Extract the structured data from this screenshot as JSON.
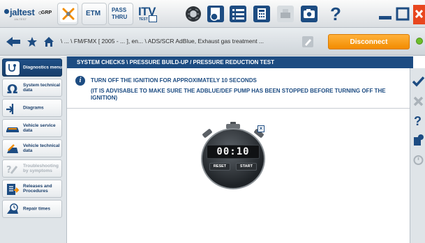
{
  "app": {
    "logo_text": "jaltest",
    "logo_sub": "JALTEST"
  },
  "toolbar": {
    "grp_label": "GRP",
    "etm_label": "ETM",
    "pass_line1": "PASS",
    "pass_line2": "THRU",
    "itv_label": "ITV",
    "itv_sub": "TEST",
    "help_label": "?"
  },
  "nav": {
    "breadcrumb": "\\ ... \\ FM/FMX [ 2005 - ... ], en... \\ ADS/SCR AdBlue, Exhaust gas treatment ...",
    "disconnect_label": "Disconnect",
    "status_color": "#6cbf2a"
  },
  "sidebar": {
    "items": [
      {
        "label": "Diagnostics menu",
        "icon": "stethoscope-icon",
        "state": "active"
      },
      {
        "label": "System technical data",
        "icon": "ohm-icon",
        "state": "normal"
      },
      {
        "label": "Diagrams",
        "icon": "diagram-icon",
        "state": "normal"
      },
      {
        "label": "Vehicle service data",
        "icon": "service-car-icon",
        "state": "normal"
      },
      {
        "label": "Vehicle technical data",
        "icon": "technical-car-icon",
        "state": "normal"
      },
      {
        "label": "Troubleshooting by symptoms",
        "icon": "troubleshooting-icon",
        "state": "disabled"
      },
      {
        "label": "Releases and Procedures",
        "icon": "releases-icon",
        "state": "normal"
      },
      {
        "label": "Repair times",
        "icon": "repair-times-icon",
        "state": "normal"
      }
    ]
  },
  "main": {
    "header": "SYSTEM CHECKS \\ PRESSURE BUILD-UP / PRESSURE REDUCTION TEST",
    "instruction": "TURN OFF THE IGNITION FOR APPROXIMATELY 10 SECONDS",
    "advice": "(IT IS ADVISABLE TO MAKE SURE THE ADBLUE/DEF PUMP HAS BEEN STOPPED BEFORE TURNING OFF THE IGNITION)",
    "stopwatch": {
      "display": "00:10",
      "reset_label": "RESET",
      "start_label": "START",
      "close_label": "×"
    }
  },
  "colors": {
    "brand_blue": "#1d4c82",
    "accent_orange": "#f28c00",
    "close_red": "#e8461e"
  }
}
